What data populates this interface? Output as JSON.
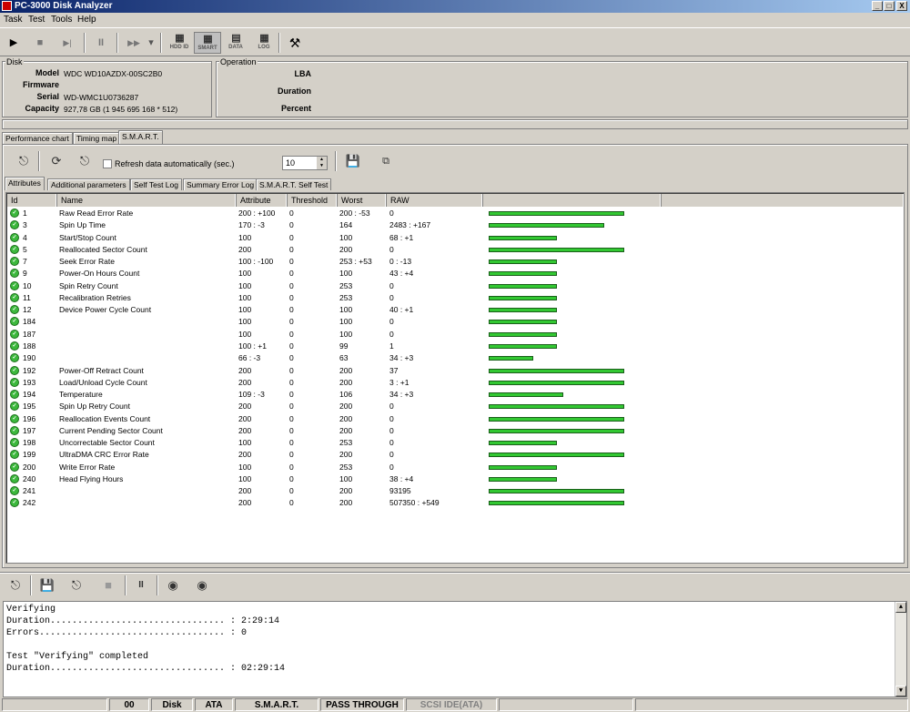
{
  "window": {
    "title": "PC-3000 Disk Analyzer",
    "buttons": [
      "_",
      "□",
      "X"
    ]
  },
  "menu": [
    "Task",
    "Test",
    "Tools",
    "Help"
  ],
  "toolbar": {
    "play_icon": "▶",
    "stop_icon": "■",
    "step_icon": "▶|",
    "pause_icon": "II",
    "ff_icon": "▶▶",
    "dropdown_icon": "▾",
    "hdd_id": "HDD ID",
    "smart": "SMART",
    "data": "DATA",
    "log": "LOG",
    "tools_icon": "⚒"
  },
  "disk": {
    "group_label": "Disk",
    "model_label": "Model",
    "model": "WDC WD10AZDX-00SC2B0",
    "firmware_label": "Firmware",
    "firmware": "",
    "serial_label": "Serial",
    "serial": "WD-WMC1U0736287",
    "capacity_label": "Capacity",
    "capacity": "927,78 GB (1 945 695 168 * 512)"
  },
  "operation": {
    "group_label": "Operation",
    "lba_label": "LBA",
    "duration_label": "Duration",
    "percent_label": "Percent"
  },
  "main_tabs": [
    "Performance chart",
    "Timing map",
    "S.M.A.R.T."
  ],
  "smart_toolbar": {
    "refresh_label": "Refresh data automatically (sec.)",
    "refresh_value": "10"
  },
  "sub_tabs": [
    "Attributes",
    "Additional parameters",
    "Self Test Log",
    "Summary Error Log",
    "S.M.A.R.T. Self Test"
  ],
  "columns": [
    "Id",
    "Name",
    "Attribute",
    "Threshold",
    "Worst",
    "RAW"
  ],
  "attributes": [
    {
      "id": "1",
      "name": "Raw Read Error Rate",
      "attribute": "200 : +100",
      "threshold": "0",
      "worst": "200 : -53",
      "raw": "0",
      "level": 1.0
    },
    {
      "id": "3",
      "name": "Spin Up Time",
      "attribute": "170 : -3",
      "threshold": "0",
      "worst": "164",
      "raw": "2483 : +167",
      "level": 0.85
    },
    {
      "id": "4",
      "name": "Start/Stop Count",
      "attribute": "100",
      "threshold": "0",
      "worst": "100",
      "raw": "68 : +1",
      "level": 0.5
    },
    {
      "id": "5",
      "name": "Reallocated Sector Count",
      "attribute": "200",
      "threshold": "0",
      "worst": "200",
      "raw": "0",
      "level": 1.0
    },
    {
      "id": "7",
      "name": "Seek Error Rate",
      "attribute": "100 : -100",
      "threshold": "0",
      "worst": "253 : +53",
      "raw": "0 : -13",
      "level": 0.5
    },
    {
      "id": "9",
      "name": "Power-On Hours Count",
      "attribute": "100",
      "threshold": "0",
      "worst": "100",
      "raw": "43 : +4",
      "level": 0.5
    },
    {
      "id": "10",
      "name": "Spin Retry Count",
      "attribute": "100",
      "threshold": "0",
      "worst": "253",
      "raw": "0",
      "level": 0.5
    },
    {
      "id": "11",
      "name": "Recalibration Retries",
      "attribute": "100",
      "threshold": "0",
      "worst": "253",
      "raw": "0",
      "level": 0.5
    },
    {
      "id": "12",
      "name": "Device Power Cycle Count",
      "attribute": "100",
      "threshold": "0",
      "worst": "100",
      "raw": "40 : +1",
      "level": 0.5
    },
    {
      "id": "184",
      "name": "",
      "attribute": "100",
      "threshold": "0",
      "worst": "100",
      "raw": "0",
      "level": 0.5
    },
    {
      "id": "187",
      "name": "",
      "attribute": "100",
      "threshold": "0",
      "worst": "100",
      "raw": "0",
      "level": 0.5
    },
    {
      "id": "188",
      "name": "",
      "attribute": "100 : +1",
      "threshold": "0",
      "worst": "99",
      "raw": "1",
      "level": 0.5
    },
    {
      "id": "190",
      "name": "",
      "attribute": "66 : -3",
      "threshold": "0",
      "worst": "63",
      "raw": "34 : +3",
      "level": 0.33
    },
    {
      "id": "192",
      "name": "Power-Off Retract Count",
      "attribute": "200",
      "threshold": "0",
      "worst": "200",
      "raw": "37",
      "level": 1.0
    },
    {
      "id": "193",
      "name": "Load/Unload Cycle Count",
      "attribute": "200",
      "threshold": "0",
      "worst": "200",
      "raw": "3 : +1",
      "level": 1.0
    },
    {
      "id": "194",
      "name": "Temperature",
      "attribute": "109 : -3",
      "threshold": "0",
      "worst": "106",
      "raw": "34 : +3",
      "level": 0.55
    },
    {
      "id": "195",
      "name": "Spin Up Retry Count",
      "attribute": "200",
      "threshold": "0",
      "worst": "200",
      "raw": "0",
      "level": 1.0
    },
    {
      "id": "196",
      "name": "Reallocation Events Count",
      "attribute": "200",
      "threshold": "0",
      "worst": "200",
      "raw": "0",
      "level": 1.0
    },
    {
      "id": "197",
      "name": "Current Pending Sector Count",
      "attribute": "200",
      "threshold": "0",
      "worst": "200",
      "raw": "0",
      "level": 1.0
    },
    {
      "id": "198",
      "name": "Uncorrectable Sector Count",
      "attribute": "100",
      "threshold": "0",
      "worst": "253",
      "raw": "0",
      "level": 0.5
    },
    {
      "id": "199",
      "name": "UltraDMA CRC Error Rate",
      "attribute": "200",
      "threshold": "0",
      "worst": "200",
      "raw": "0",
      "level": 1.0
    },
    {
      "id": "200",
      "name": "Write Error Rate",
      "attribute": "100",
      "threshold": "0",
      "worst": "253",
      "raw": "0",
      "level": 0.5
    },
    {
      "id": "240",
      "name": "Head Flying Hours",
      "attribute": "100",
      "threshold": "0",
      "worst": "100",
      "raw": "38 : +4",
      "level": 0.5
    },
    {
      "id": "241",
      "name": "",
      "attribute": "200",
      "threshold": "0",
      "worst": "200",
      "raw": "93195",
      "level": 1.0
    },
    {
      "id": "242",
      "name": "",
      "attribute": "200",
      "threshold": "0",
      "worst": "200",
      "raw": "507350 : +549",
      "level": 1.0
    }
  ],
  "log": [
    "Verifying",
    "Duration................................ : 2:29:14",
    "Errors.................................. : 0",
    "",
    "Test \"Verifying\" completed",
    "Duration................................ : 02:29:14"
  ],
  "status": {
    "port": "00",
    "disk": "Disk",
    "ata": "ATA",
    "smart": "S.M.A.R.T.",
    "mode": "PASS THROUGH",
    "iface": "SCSI IDE(ATA)"
  },
  "colors": {
    "bar": "#32c832",
    "title_start": "#0a246a",
    "title_end": "#a6caf0"
  }
}
